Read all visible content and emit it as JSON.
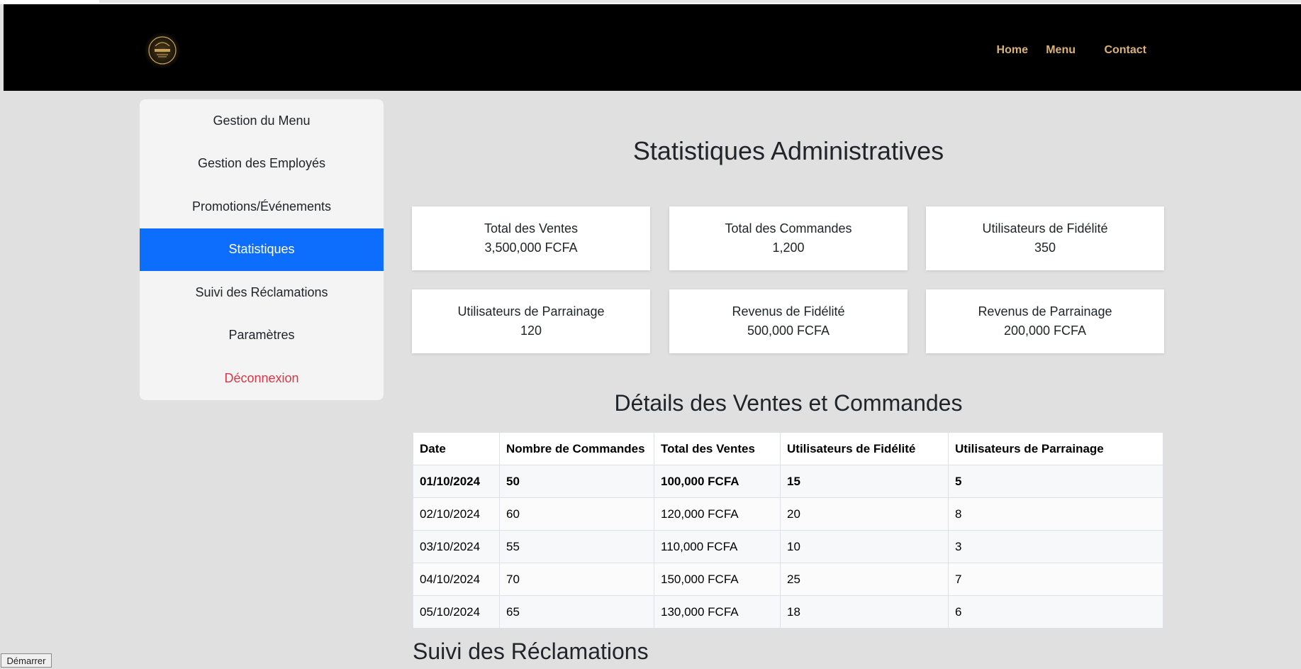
{
  "nav": {
    "logo_icon": "restaurant-logo-icon",
    "items": [
      "Home",
      "Menu",
      "Contact"
    ],
    "color": "#d9b27a"
  },
  "sidebar": {
    "items": [
      {
        "label": "Gestion du Menu"
      },
      {
        "label": "Gestion des Employés"
      },
      {
        "label": "Promotions/Événements"
      },
      {
        "label": "Statistiques",
        "active": true
      },
      {
        "label": "Suivi des Réclamations"
      },
      {
        "label": "Paramètres"
      },
      {
        "label": "Déconnexion"
      }
    ],
    "active_color": "#0d6efd",
    "logout_color": "#dc3545"
  },
  "main": {
    "title": "Statistiques Administratives",
    "cards": [
      {
        "label": "Total des Ventes",
        "value": "3,500,000 FCFA"
      },
      {
        "label": "Total des Commandes",
        "value": "1,200"
      },
      {
        "label": "Utilisateurs de Fidélité",
        "value": "350"
      },
      {
        "label": "Utilisateurs de Parrainage",
        "value": "120"
      },
      {
        "label": "Revenus de Fidélité",
        "value": "500,000 FCFA"
      },
      {
        "label": "Revenus de Parrainage",
        "value": "200,000 FCFA"
      }
    ],
    "details_title": "Détails des Ventes et Commandes",
    "table": {
      "headers": [
        "Date",
        "Nombre de Commandes",
        "Total des Ventes",
        "Utilisateurs de Fidélité",
        "Utilisateurs de Parrainage"
      ],
      "rows": [
        [
          "01/10/2024",
          "50",
          "100,000 FCFA",
          "15",
          "5"
        ],
        [
          "02/10/2024",
          "60",
          "120,000 FCFA",
          "20",
          "8"
        ],
        [
          "03/10/2024",
          "55",
          "110,000 FCFA",
          "10",
          "3"
        ],
        [
          "04/10/2024",
          "70",
          "150,000 FCFA",
          "25",
          "7"
        ],
        [
          "05/10/2024",
          "65",
          "130,000 FCFA",
          "18",
          "6"
        ]
      ]
    },
    "claims_title": "Suivi des Réclamations"
  },
  "taskbar": {
    "start_label": "Démarrer"
  }
}
